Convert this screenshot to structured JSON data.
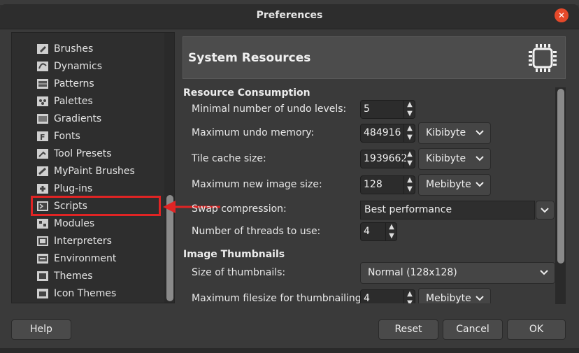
{
  "window": {
    "title": "Preferences"
  },
  "tree": {
    "items": [
      {
        "label": "Brushes",
        "icon": "brush-icon"
      },
      {
        "label": "Dynamics",
        "icon": "dynamics-icon"
      },
      {
        "label": "Patterns",
        "icon": "patterns-icon"
      },
      {
        "label": "Palettes",
        "icon": "palettes-icon"
      },
      {
        "label": "Gradients",
        "icon": "gradients-icon"
      },
      {
        "label": "Fonts",
        "icon": "fonts-icon"
      },
      {
        "label": "Tool Presets",
        "icon": "tool-presets-icon"
      },
      {
        "label": "MyPaint Brushes",
        "icon": "mypaint-brushes-icon"
      },
      {
        "label": "Plug-ins",
        "icon": "plugins-icon"
      },
      {
        "label": "Scripts",
        "icon": "scripts-icon"
      },
      {
        "label": "Modules",
        "icon": "modules-icon"
      },
      {
        "label": "Interpreters",
        "icon": "interpreters-icon"
      },
      {
        "label": "Environment",
        "icon": "environment-icon"
      },
      {
        "label": "Themes",
        "icon": "themes-icon"
      },
      {
        "label": "Icon Themes",
        "icon": "icon-themes-icon"
      }
    ],
    "highlighted": "Scripts"
  },
  "annotation": {
    "color": "#e02424"
  },
  "page": {
    "title": "System Resources",
    "icon": "chip-icon",
    "sections": {
      "resource": "Resource Consumption",
      "thumbnails": "Image Thumbnails"
    },
    "fields": {
      "undo_levels": {
        "label": "Minimal number of undo levels:",
        "value": "5"
      },
      "undo_memory": {
        "label": "Maximum undo memory:",
        "value": "484916",
        "unit": "Kibibyte"
      },
      "tile_cache": {
        "label": "Tile cache size:",
        "value": "1939662",
        "unit": "Kibibyte"
      },
      "new_image": {
        "label": "Maximum new image size:",
        "value": "128",
        "unit": "Mebibyte"
      },
      "swap": {
        "label": "Swap compression:",
        "value": "Best performance"
      },
      "threads": {
        "label": "Number of threads to use:",
        "value": "4"
      },
      "thumb_size": {
        "label": "Size of thumbnails:",
        "value": "Normal (128x128)"
      },
      "thumb_filesize": {
        "label": "Maximum filesize for thumbnailing:",
        "value": "4",
        "unit": "Mebibyte"
      }
    }
  },
  "buttons": {
    "help": "Help",
    "reset": "Reset",
    "cancel": "Cancel",
    "ok": "OK"
  },
  "close_glyph": "✕"
}
